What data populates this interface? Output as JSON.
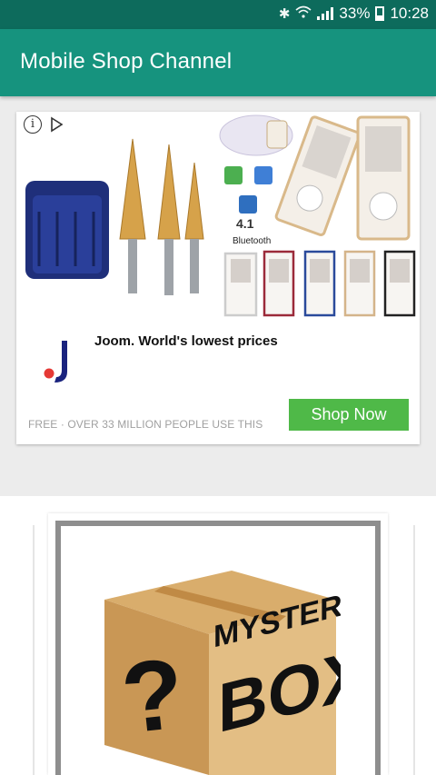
{
  "status_bar": {
    "battery": "33%",
    "time": "10:28",
    "icons": [
      "bluetooth-icon",
      "wifi-icon",
      "signal-icon",
      "battery-icon"
    ]
  },
  "app_bar": {
    "title": "Mobile Shop Channel",
    "color": "#16937e"
  },
  "ad": {
    "image_labels": {
      "version": "4.1",
      "bluetooth": "Bluetooth"
    },
    "headline": "Joom. World's lowest prices",
    "footer_text": "FREE · OVER 33 MILLION PEOPLE USE THIS",
    "cta_label": "Shop Now",
    "cta_color": "#4fb948"
  },
  "product": {
    "box_lines": [
      "MYSTERY",
      "BOX"
    ],
    "question_mark": "?"
  }
}
